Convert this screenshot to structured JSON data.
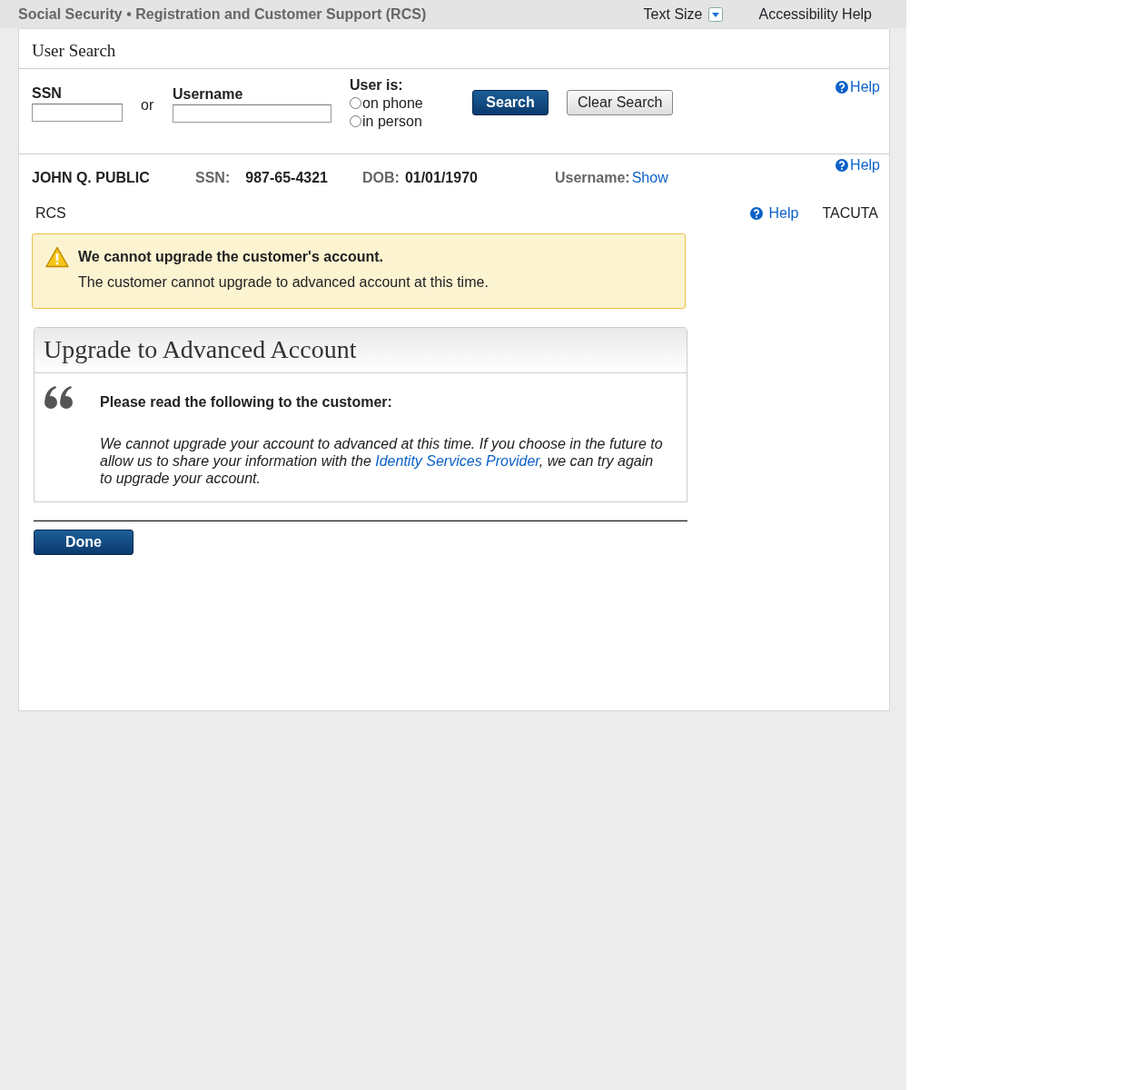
{
  "header": {
    "title": "Social Security • Registration and Customer Support (RCS)",
    "text_size": "Text Size",
    "accessibility": "Accessibility Help"
  },
  "panel_title": "User Search",
  "search": {
    "ssn_label": "SSN",
    "or": "or",
    "username_label": "Username",
    "user_is_label": "User is:",
    "options": [
      {
        "label": "on phone",
        "selected": false
      },
      {
        "label": "in person",
        "selected": false
      }
    ],
    "search_button": "Search",
    "clear_button": "Clear Search",
    "help": "Help"
  },
  "customer": {
    "name": "JOHN Q. PUBLIC",
    "ssn_label": "SSN:",
    "ssn": "987-65-4321",
    "dob_label": "DOB:",
    "dob": "01/01/1970",
    "username_label": "Username:",
    "username_link": "Show",
    "help": "Help"
  },
  "context": {
    "app": "RCS",
    "help": "Help",
    "user": "TACUTA"
  },
  "alert": {
    "kind": "warning",
    "title": "We cannot upgrade the customer's account.",
    "message": "The customer cannot upgrade to advanced account at this time."
  },
  "card": {
    "title": "Upgrade to Advanced Account",
    "instruction": "Please read the following to the customer:",
    "script_before": "We cannot upgrade your account to advanced at this time. If you choose in the future to allow us to share your information with the ",
    "script_link": "Identity Services Provider",
    "script_after": ", we can try again to upgrade your account."
  },
  "done_button": "Done"
}
